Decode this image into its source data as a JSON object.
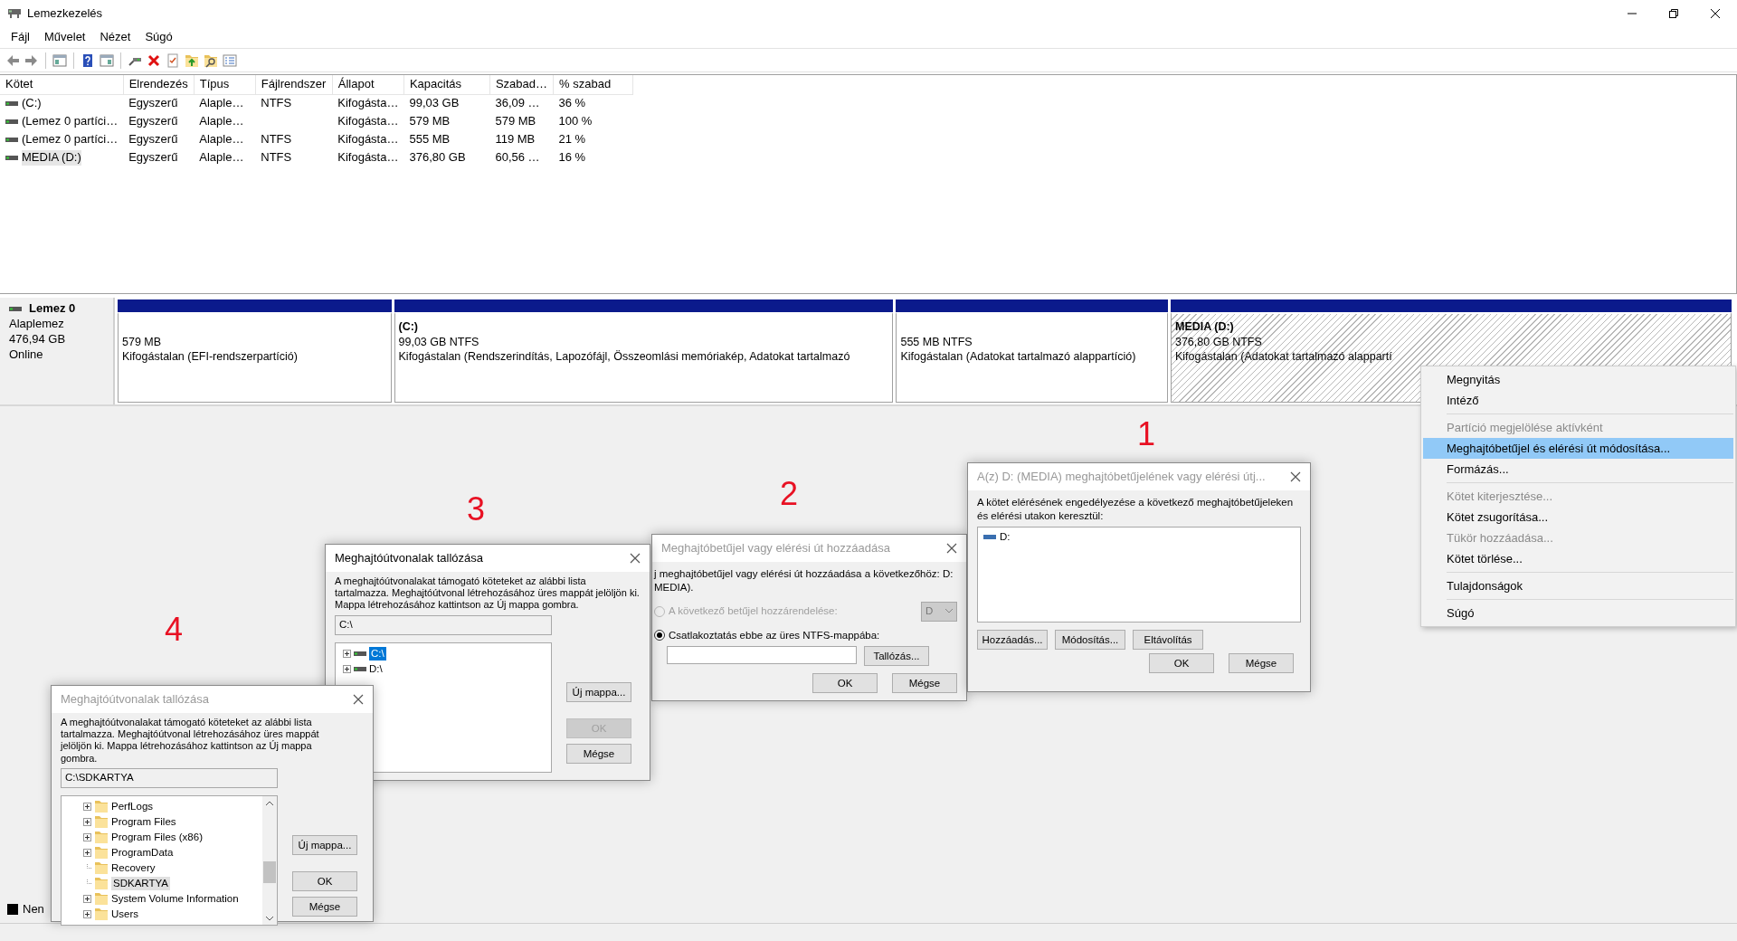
{
  "window": {
    "title": "Lemezkezelés"
  },
  "menu": [
    "Fájl",
    "Művelet",
    "Nézet",
    "Súgó"
  ],
  "volumes": {
    "columns": [
      "Kötet",
      "Elrendezés",
      "Típus",
      "Fájlrendszer",
      "Állapot",
      "Kapacitás",
      "Szabad…",
      "% szabad"
    ],
    "rows": [
      {
        "cells": [
          "(C:)",
          "Egyszerű",
          "Alaple…",
          "NTFS",
          "Kifogásta…",
          "99,03 GB",
          "36,09 …",
          "36 %"
        ],
        "selected": false
      },
      {
        "cells": [
          "(Lemez 0 partíci…",
          "Egyszerű",
          "Alaple…",
          "",
          "Kifogásta…",
          "579 MB",
          "579 MB",
          "100 %"
        ],
        "selected": false
      },
      {
        "cells": [
          "(Lemez 0 partíci…",
          "Egyszerű",
          "Alaple…",
          "NTFS",
          "Kifogásta…",
          "555 MB",
          "119 MB",
          "21 %"
        ],
        "selected": false
      },
      {
        "cells": [
          "MEDIA (D:)",
          "Egyszerű",
          "Alaple…",
          "NTFS",
          "Kifogásta…",
          "376,80 GB",
          "60,56 …",
          "16 %"
        ],
        "selected": true
      }
    ]
  },
  "disk": {
    "name": "Lemez 0",
    "type": "Alaplemez",
    "size": "476,94 GB",
    "status": "Online",
    "partitions": [
      {
        "size": "579 MB",
        "status": "Kifogástalan (EFI-rendszerpartíció)",
        "selected": false
      },
      {
        "label": "(C:)",
        "size": "99,03 GB NTFS",
        "status": "Kifogástalan (Rendszerindítás, Lapozófájl, Összeomlási memóriakép, Adatokat tartalmazó",
        "selected": false
      },
      {
        "size": "555 MB NTFS",
        "status": "Kifogástalan (Adatokat tartalmazó alappartíció)",
        "selected": false
      },
      {
        "label": "MEDIA  (D:)",
        "size": "376,80 GB NTFS",
        "status": "Kifogástalan (Adatokat tartalmazó alappartí",
        "selected": true
      }
    ]
  },
  "legend": [
    {
      "label": "Nen",
      "color": "#000000"
    }
  ],
  "context_menu": [
    {
      "kind": "item",
      "label": "Megnyitás",
      "disabled": false,
      "selected": false
    },
    {
      "kind": "item",
      "label": "Intéző",
      "disabled": false,
      "selected": false
    },
    {
      "kind": "separator"
    },
    {
      "kind": "item",
      "label": "Partíció megjelölése aktívként",
      "disabled": true,
      "selected": false
    },
    {
      "kind": "item",
      "label": "Meghajtóbetűjel és elérési út módosítása...",
      "disabled": false,
      "selected": true
    },
    {
      "kind": "item",
      "label": "Formázás...",
      "disabled": false,
      "selected": false
    },
    {
      "kind": "separator"
    },
    {
      "kind": "item",
      "label": "Kötet kiterjesztése...",
      "disabled": true,
      "selected": false
    },
    {
      "kind": "item",
      "label": "Kötet zsugorítása...",
      "disabled": false,
      "selected": false
    },
    {
      "kind": "item",
      "label": "Tükör hozzáadása...",
      "disabled": true,
      "selected": false
    },
    {
      "kind": "item",
      "label": "Kötet törlése...",
      "disabled": false,
      "selected": false
    },
    {
      "kind": "separator"
    },
    {
      "kind": "item",
      "label": "Tulajdonságok",
      "disabled": false,
      "selected": false
    },
    {
      "kind": "separator"
    },
    {
      "kind": "item",
      "label": "Súgó",
      "disabled": false,
      "selected": false
    }
  ],
  "step_numbers": [
    "1",
    "2",
    "3",
    "4"
  ],
  "change_letter_dialog": {
    "title": "A(z) D: (MEDIA) meghajtóbetűjelének vagy elérési útj...",
    "active": false,
    "text": "A kötet elérésének engedélyezése a következő meghajtóbetűjeleken és elérési utakon keresztül:",
    "paths": [
      {
        "label": "D:",
        "selected": false
      }
    ],
    "buttons": [
      {
        "label": "Hozzáadás...",
        "disabled": false
      },
      {
        "label": "Módosítás...",
        "disabled": false
      },
      {
        "label": "Eltávolítás",
        "disabled": false
      }
    ],
    "footer_buttons": [
      {
        "label": "OK",
        "disabled": false
      },
      {
        "label": "Mégse",
        "disabled": false
      }
    ]
  },
  "add_letter_dialog": {
    "title": "Meghajtóbetűjel vagy elérési út hozzáadása",
    "active": false,
    "intro_lines": [
      "j meghajtóbetűjel vagy elérési út hozzáadása a következőhöz: D:",
      "MEDIA)."
    ],
    "options": [
      {
        "label": "A következő betűjel hozzárendelése:",
        "selected": false,
        "disabled": true
      },
      {
        "label": "Csatlakoztatás ebbe az üres NTFS-mappába:",
        "selected": true,
        "disabled": false
      }
    ],
    "letter": {
      "value": "D",
      "disabled": true
    },
    "browse_button": "Tallózás...",
    "footer_buttons": [
      {
        "label": "OK",
        "disabled": false
      },
      {
        "label": "Mégse",
        "disabled": false
      }
    ]
  },
  "browse_dialogs": [
    {
      "title": "Meghajtóútvonalak tallózása",
      "active": true,
      "text": "A meghajtóútvonalakat támogató köteteket az alábbi lista tartalmazza. Meghajtóútvonal létrehozásához üres mappát jelöljön ki. Mappa létrehozásához kattintson az Új mappa gombra.",
      "path": "C:\\",
      "nodes": [
        {
          "kind": "drive",
          "label": "C:\\",
          "expandable": true,
          "selected": true
        },
        {
          "kind": "drive",
          "label": "D:\\",
          "expandable": true,
          "selected": false
        }
      ],
      "buttons": [
        {
          "label": "Új mappa...",
          "disabled": false
        },
        {
          "label": "OK",
          "disabled": true
        },
        {
          "label": "Mégse",
          "disabled": false
        }
      ]
    },
    {
      "title": "Meghajtóútvonalak tallózása",
      "active": false,
      "text": "A meghajtóútvonalakat támogató köteteket az alábbi lista tartalmazza. Meghajtóútvonal létrehozásához üres mappát jelöljön ki. Mappa létrehozásához kattintson az Új mappa gombra.",
      "path": "C:\\SDKARTYA",
      "nodes": [
        {
          "kind": "folder",
          "label": "PerfLogs",
          "expandable": true,
          "selected": false
        },
        {
          "kind": "folder",
          "label": "Program Files",
          "expandable": true,
          "selected": false
        },
        {
          "kind": "folder",
          "label": "Program Files (x86)",
          "expandable": true,
          "selected": false
        },
        {
          "kind": "folder",
          "label": "ProgramData",
          "expandable": true,
          "selected": false
        },
        {
          "kind": "folder",
          "label": "Recovery",
          "expandable": false,
          "selected": false
        },
        {
          "kind": "folder",
          "label": "SDKARTYA",
          "expandable": false,
          "selected": true
        },
        {
          "kind": "folder",
          "label": "System Volume Information",
          "expandable": true,
          "selected": false
        },
        {
          "kind": "folder",
          "label": "Users",
          "expandable": true,
          "selected": false
        }
      ],
      "buttons": [
        {
          "label": "Új mappa...",
          "disabled": false
        },
        {
          "label": "OK",
          "disabled": false
        },
        {
          "label": "Mégse",
          "disabled": false
        }
      ]
    }
  ]
}
